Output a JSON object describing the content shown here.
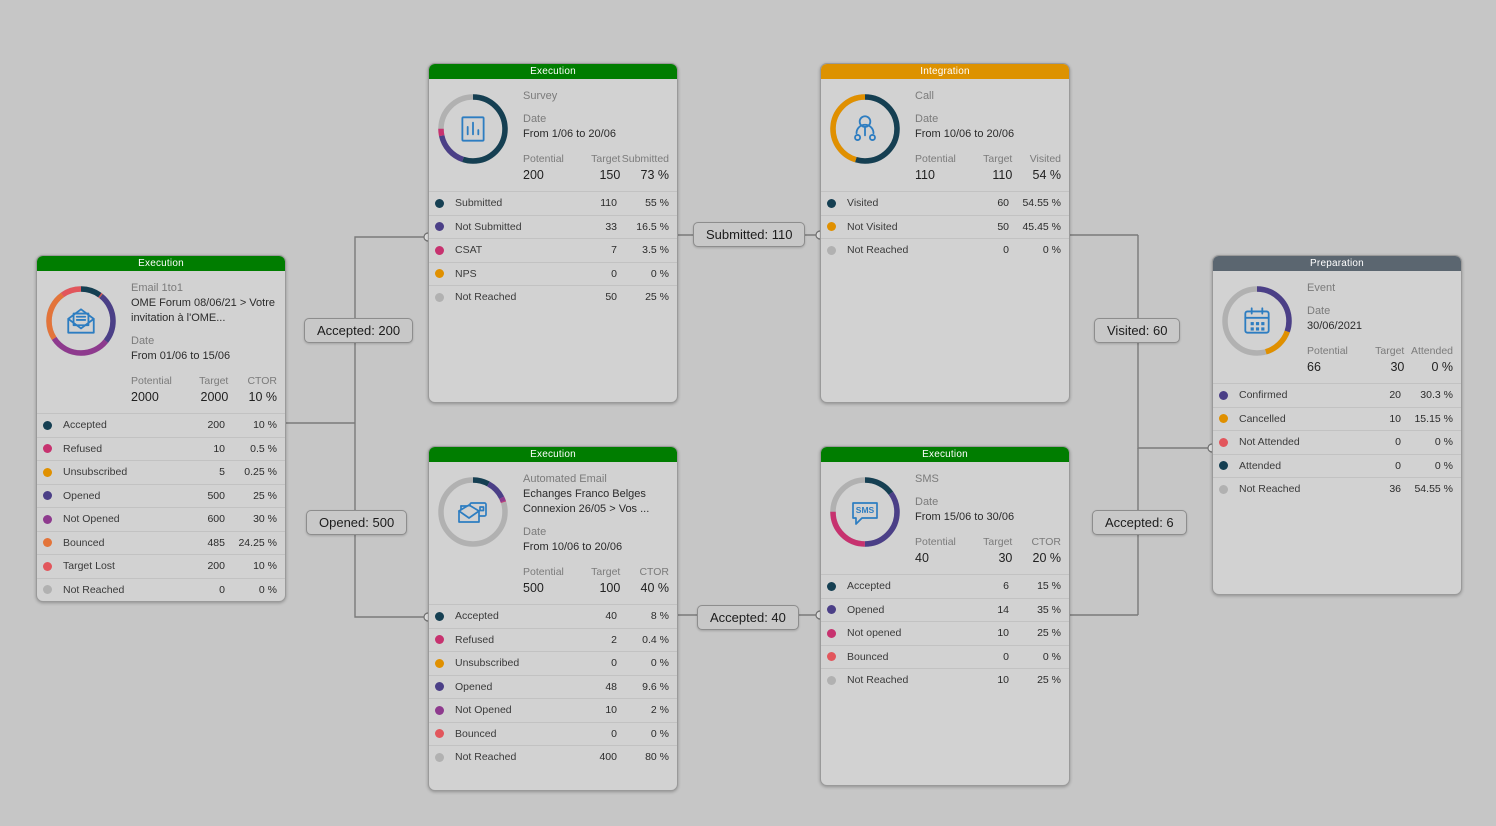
{
  "canvas": {
    "background": "#c6c6c6"
  },
  "palette": {
    "execution_header": "#007d00",
    "integration_header": "#dd9200",
    "preparation_header": "#5b6670",
    "navy": "#153f52",
    "pink": "#c7326f",
    "amber": "#e09000",
    "indigo": "#4b3f87",
    "purple": "#8e3a8e",
    "orange": "#e3743a",
    "red": "#e2565c",
    "grey": "#b1b1b1"
  },
  "cards": [
    {
      "id": "email-1to1",
      "header": "Execution",
      "header_type": "execution",
      "icon": "envelope-icon",
      "subtitle": "Email 1to1",
      "name_lines": [
        "OME Forum 08/06/21 > Votre",
        "invitation à l'OME..."
      ],
      "date_label": "Date",
      "date_value": "From 01/06 to 15/06",
      "kpis": [
        {
          "label": "Potential",
          "value": "2000"
        },
        {
          "label": "Target",
          "value": "2000"
        },
        {
          "label": "CTOR",
          "value": "10 %"
        }
      ],
      "donut": [
        {
          "color": "#153f52",
          "pct": 10
        },
        {
          "color": "#c7326f",
          "pct": 0.5
        },
        {
          "color": "#e09000",
          "pct": 0.25
        },
        {
          "color": "#4b3f87",
          "pct": 25
        },
        {
          "color": "#8e3a8e",
          "pct": 30
        },
        {
          "color": "#e3743a",
          "pct": 24.25
        },
        {
          "color": "#e2565c",
          "pct": 10
        }
      ],
      "stats": [
        {
          "color": "#153f52",
          "name": "Accepted",
          "count": "200",
          "pct": "10 %"
        },
        {
          "color": "#c7326f",
          "name": "Refused",
          "count": "10",
          "pct": "0.5 %"
        },
        {
          "color": "#e09000",
          "name": "Unsubscribed",
          "count": "5",
          "pct": "0.25 %"
        },
        {
          "color": "#4b3f87",
          "name": "Opened",
          "count": "500",
          "pct": "25 %"
        },
        {
          "color": "#8e3a8e",
          "name": "Not Opened",
          "count": "600",
          "pct": "30 %"
        },
        {
          "color": "#e3743a",
          "name": "Bounced",
          "count": "485",
          "pct": "24.25 %"
        },
        {
          "color": "#e2565c",
          "name": "Target Lost",
          "count": "200",
          "pct": "10 %"
        },
        {
          "color": "#b1b1b1",
          "name": "Not Reached",
          "count": "0",
          "pct": "0 %"
        }
      ]
    },
    {
      "id": "survey",
      "header": "Execution",
      "header_type": "execution",
      "icon": "bar-chart-icon",
      "subtitle": "Survey",
      "name_lines": [],
      "date_label": "Date",
      "date_value": "From 1/06 to 20/06",
      "kpis": [
        {
          "label": "Potential",
          "value": "200"
        },
        {
          "label": "Target",
          "value": "150"
        },
        {
          "label": "Submitted",
          "value": "73 %"
        }
      ],
      "donut": [
        {
          "color": "#153f52",
          "pct": 55
        },
        {
          "color": "#4b3f87",
          "pct": 16.5
        },
        {
          "color": "#c7326f",
          "pct": 3.5
        },
        {
          "color": "#e09000",
          "pct": 0
        }
      ],
      "stats": [
        {
          "color": "#153f52",
          "name": "Submitted",
          "count": "110",
          "pct": "55 %"
        },
        {
          "color": "#4b3f87",
          "name": "Not Submitted",
          "count": "33",
          "pct": "16.5 %"
        },
        {
          "color": "#c7326f",
          "name": "CSAT",
          "count": "7",
          "pct": "3.5 %"
        },
        {
          "color": "#e09000",
          "name": "NPS",
          "count": "0",
          "pct": "0 %"
        },
        {
          "color": "#b1b1b1",
          "name": "Not Reached",
          "count": "50",
          "pct": "25 %"
        }
      ]
    },
    {
      "id": "call",
      "header": "Integration",
      "header_type": "integration",
      "icon": "person-icon",
      "subtitle": "Call",
      "name_lines": [],
      "date_label": "Date",
      "date_value": "From 10/06 to 20/06",
      "kpis": [
        {
          "label": "Potential",
          "value": "110"
        },
        {
          "label": "Target",
          "value": "110"
        },
        {
          "label": "Visited",
          "value": "54 %"
        }
      ],
      "donut": [
        {
          "color": "#153f52",
          "pct": 54.55
        },
        {
          "color": "#e09000",
          "pct": 45.45
        }
      ],
      "stats": [
        {
          "color": "#153f52",
          "name": "Visited",
          "count": "60",
          "pct": "54.55 %"
        },
        {
          "color": "#e09000",
          "name": "Not Visited",
          "count": "50",
          "pct": "45.45 %"
        },
        {
          "color": "#b1b1b1",
          "name": "Not Reached",
          "count": "0",
          "pct": "0 %"
        }
      ]
    },
    {
      "id": "event",
      "header": "Preparation",
      "header_type": "preparation",
      "icon": "calendar-icon",
      "subtitle": "Event",
      "name_lines": [],
      "date_label": "Date",
      "date_value": "30/06/2021",
      "kpis": [
        {
          "label": "Potential",
          "value": "66"
        },
        {
          "label": "Target",
          "value": "30"
        },
        {
          "label": "Attended",
          "value": "0 %"
        }
      ],
      "donut": [
        {
          "color": "#4b3f87",
          "pct": 30.3
        },
        {
          "color": "#e09000",
          "pct": 15.15
        }
      ],
      "stats": [
        {
          "color": "#4b3f87",
          "name": "Confirmed",
          "count": "20",
          "pct": "30.3 %"
        },
        {
          "color": "#e09000",
          "name": "Cancelled",
          "count": "10",
          "pct": "15.15 %"
        },
        {
          "color": "#e2565c",
          "name": "Not Attended",
          "count": "0",
          "pct": "0 %"
        },
        {
          "color": "#153f52",
          "name": "Attended",
          "count": "0",
          "pct": "0 %"
        },
        {
          "color": "#b1b1b1",
          "name": "Not Reached",
          "count": "36",
          "pct": "54.55 %"
        }
      ]
    },
    {
      "id": "automated-email",
      "header": "Execution",
      "header_type": "execution",
      "icon": "emails-icon",
      "subtitle": "Automated Email",
      "name_lines": [
        "Echanges Franco Belges",
        "Connexion 26/05 > Vos ..."
      ],
      "date_label": "Date",
      "date_value": "From 10/06 to 20/06",
      "kpis": [
        {
          "label": "Potential",
          "value": "500"
        },
        {
          "label": "Target",
          "value": "100"
        },
        {
          "label": "CTOR",
          "value": "40 %"
        }
      ],
      "donut": [
        {
          "color": "#153f52",
          "pct": 8
        },
        {
          "color": "#4b3f87",
          "pct": 9.6
        },
        {
          "color": "#8e3a8e",
          "pct": 2
        },
        {
          "color": "#c7326f",
          "pct": 0.4
        }
      ],
      "stats": [
        {
          "color": "#153f52",
          "name": "Accepted",
          "count": "40",
          "pct": "8 %"
        },
        {
          "color": "#c7326f",
          "name": "Refused",
          "count": "2",
          "pct": "0.4 %"
        },
        {
          "color": "#e09000",
          "name": "Unsubscribed",
          "count": "0",
          "pct": "0 %"
        },
        {
          "color": "#4b3f87",
          "name": "Opened",
          "count": "48",
          "pct": "9.6 %"
        },
        {
          "color": "#8e3a8e",
          "name": "Not Opened",
          "count": "10",
          "pct": "2 %"
        },
        {
          "color": "#e2565c",
          "name": "Bounced",
          "count": "0",
          "pct": "0 %"
        },
        {
          "color": "#b1b1b1",
          "name": "Not Reached",
          "count": "400",
          "pct": "80 %"
        }
      ]
    },
    {
      "id": "sms",
      "header": "Execution",
      "header_type": "execution",
      "icon": "sms-icon",
      "subtitle": "SMS",
      "name_lines": [],
      "date_label": "Date",
      "date_value": "From 15/06 to 30/06",
      "kpis": [
        {
          "label": "Potential",
          "value": "40"
        },
        {
          "label": "Target",
          "value": "30"
        },
        {
          "label": "CTOR",
          "value": "20 %"
        }
      ],
      "donut": [
        {
          "color": "#153f52",
          "pct": 15
        },
        {
          "color": "#4b3f87",
          "pct": 35
        },
        {
          "color": "#c7326f",
          "pct": 25
        }
      ],
      "stats": [
        {
          "color": "#153f52",
          "name": "Accepted",
          "count": "6",
          "pct": "15 %"
        },
        {
          "color": "#4b3f87",
          "name": "Opened",
          "count": "14",
          "pct": "35 %"
        },
        {
          "color": "#c7326f",
          "name": "Not opened",
          "count": "10",
          "pct": "25 %"
        },
        {
          "color": "#e2565c",
          "name": "Bounced",
          "count": "0",
          "pct": "0 %"
        },
        {
          "color": "#b1b1b1",
          "name": "Not Reached",
          "count": "10",
          "pct": "25 %"
        }
      ]
    }
  ],
  "connectors": [
    {
      "id": "accepted-200",
      "label": "Accepted: 200"
    },
    {
      "id": "opened-500",
      "label": "Opened: 500"
    },
    {
      "id": "submitted-110",
      "label": "Submitted: 110"
    },
    {
      "id": "accepted-40",
      "label": "Accepted: 40"
    },
    {
      "id": "visited-60",
      "label": "Visited: 60"
    },
    {
      "id": "accepted-6",
      "label": "Accepted: 6"
    }
  ]
}
